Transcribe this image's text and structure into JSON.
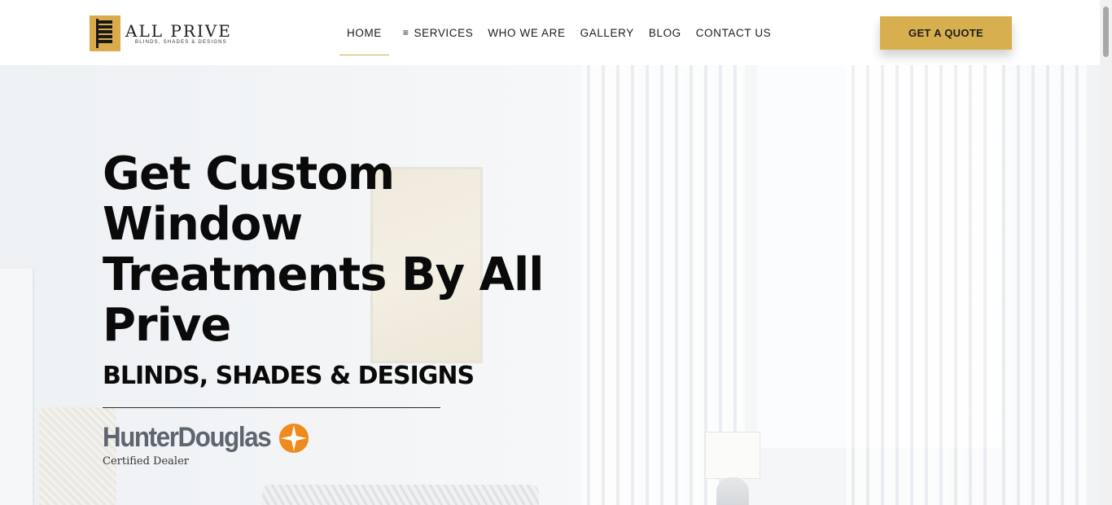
{
  "header": {
    "logo": {
      "title": "ALL PRIVE",
      "subtitle": "BLINDS, SHADES & DESIGNS"
    },
    "nav": [
      {
        "label": "HOME",
        "active": true
      },
      {
        "label": "SERVICES",
        "icon": "menu-icon"
      },
      {
        "label": "WHO WE ARE"
      },
      {
        "label": "GALLERY"
      },
      {
        "label": "BLOG"
      },
      {
        "label": "CONTACT US"
      }
    ],
    "cta_label": "GET A QUOTE"
  },
  "hero": {
    "title_lines": [
      "Get Custom",
      "Window",
      "Treatments By All",
      "Prive"
    ],
    "subtitle": "BLINDS, SHADES & DESIGNS",
    "partner": {
      "name": "HunterDouglas",
      "caption": "Certified Dealer"
    }
  },
  "colors": {
    "accent_gold": "#d8af4f",
    "partner_orange": "#f08a1c",
    "partner_gray": "#5d6670",
    "text_dark": "#0a0a0a"
  }
}
